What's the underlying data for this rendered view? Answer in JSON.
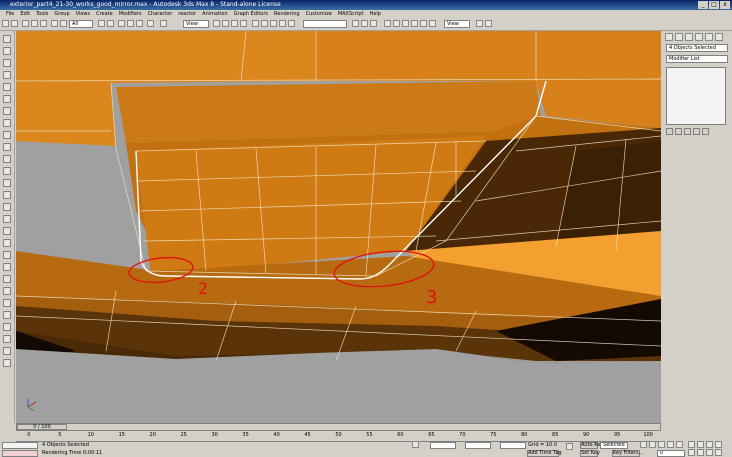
{
  "window": {
    "title": "exterior_part4_21-30_works_good_mirror.max - Autodesk 3ds Max 8 - Stand-alone License",
    "controls": [
      "_",
      "□",
      "x"
    ]
  },
  "menu": [
    "File",
    "Edit",
    "Tools",
    "Group",
    "Views",
    "Create",
    "Modifiers",
    "Character",
    "reactor",
    "Animation",
    "Graph Editors",
    "Rendering",
    "Customize",
    "MAXScript",
    "Help"
  ],
  "toolbar": {
    "selection_filter": "All",
    "ref_coord": "View",
    "named_selection": "",
    "view_dropdown": "View"
  },
  "command_panel": {
    "selection_text": "4 Objects Selected",
    "modifier_list": "Modifier List"
  },
  "timeline": {
    "slider_label": "0 / 100",
    "ticks": [
      "0",
      "5",
      "10",
      "15",
      "20",
      "25",
      "30",
      "35",
      "40",
      "45",
      "50",
      "55",
      "60",
      "65",
      "70",
      "75",
      "80",
      "85",
      "90",
      "95",
      "100"
    ]
  },
  "status": {
    "objects_selected": "4 Objects Selected",
    "rendering_time": "Rendering Time  0:00:11",
    "grid": "Grid = 10.0",
    "add_time_tag": "Add Time Tag",
    "auto_key": "Auto Key",
    "set_key": "Set Key",
    "key_mode": "Selected",
    "key_filters": "Key Filters...",
    "frame": "0"
  },
  "annotations": [
    "2",
    "3"
  ],
  "colors": {
    "mesh_orange": "#d8801a",
    "mesh_dark": "#4a2806",
    "mesh_bright": "#f4a030",
    "annotation_red": "#e01010",
    "ground_gray": "#a0a0a0"
  }
}
